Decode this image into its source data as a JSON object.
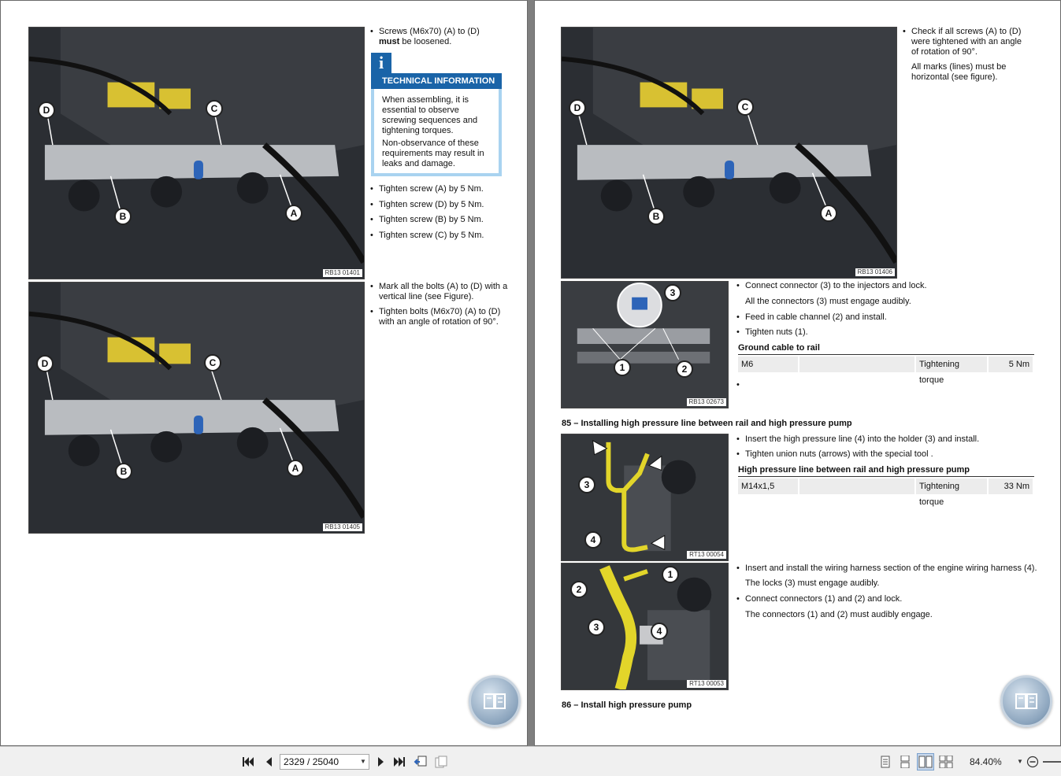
{
  "left_page": {
    "photo1": {
      "code": "RB13 01401",
      "labels": [
        "D",
        "C",
        "B",
        "A"
      ]
    },
    "photo2": {
      "code": "RB13 01405",
      "labels": [
        "D",
        "C",
        "B",
        "A"
      ]
    },
    "step1": {
      "pre": "Screws (M6x70) (A) to (D) ",
      "bold": "must",
      "post": " be loosened."
    },
    "tech_info": {
      "icon": "i",
      "title": "TECHNICAL INFORMATION",
      "p1": "When assembling, it is essential to observe screwing sequences and tightening torques.",
      "p2": "Non-observance of these requirements may result in leaks and damage."
    },
    "tighten": [
      "Tighten screw (A) by 5 Nm.",
      "Tighten screw (D) by 5 Nm.",
      "Tighten screw (B) by 5 Nm.",
      "Tighten screw (C) by 5 Nm."
    ],
    "mark": "Mark all the bolts (A) to (D) with a vertical line (see Figure).",
    "tighten_angle": "Tighten bolts (M6x70) (A) to (D) with an angle of rotation of 90°."
  },
  "right_page": {
    "photo1": {
      "code": "RB13 01406",
      "labels": [
        "D",
        "C",
        "B",
        "A"
      ]
    },
    "check": "Check if all screws (A) to (D) were tightened with an angle of rotation of 90°.",
    "check_note": "All marks (lines) must be horizontal (see figure).",
    "photo2": {
      "code": "RB13 02673",
      "labels": [
        "3",
        "1",
        "2"
      ]
    },
    "connect_injectors": "Connect connector (3) to the injectors and lock.",
    "connect_note": "All the connectors (3) must engage audibly.",
    "feed_cable": "Feed in cable channel (2) and install.",
    "tighten_nuts": "Tighten nuts (1).",
    "ground_heading": "Ground cable to rail",
    "ground_row": {
      "spec": "M6",
      "label": "Tightening torque",
      "value": "5 Nm"
    },
    "section85": "85 – Installing high pressure line between rail and high pressure pump",
    "photo3": {
      "code": "RT13 00054",
      "labels": [
        "3",
        "4"
      ]
    },
    "insert_line": "Insert the high pressure line (4) into the holder (3) and install.",
    "tighten_union": "Tighten union nuts (arrows) with the special tool .",
    "hp_heading": "High pressure line between rail and high pressure pump",
    "hp_row": {
      "spec": "M14x1,5",
      "label": "Tightening torque",
      "value": "33 Nm"
    },
    "photo4": {
      "code": "RT13 00053",
      "labels": [
        "1",
        "2",
        "3",
        "4"
      ]
    },
    "insert_harness": "Insert and install the wiring harness section of the engine wiring harness (4).",
    "locks_note": "The locks (3) must engage audibly.",
    "connect_12": "Connect connectors (1) and (2) and lock.",
    "connect_12_note": "The connectors (1) and (2) must audibly engage.",
    "section86": "86 – Install high pressure pump"
  },
  "toolbar": {
    "page_field": "2329 / 25040",
    "zoom": "84.40%"
  },
  "colors": {
    "tech_blue": "#1a64a8",
    "tech_border": "#a9d3f0",
    "page_bg": "#ffffff",
    "viewer_bg": "#7f7f7f"
  }
}
